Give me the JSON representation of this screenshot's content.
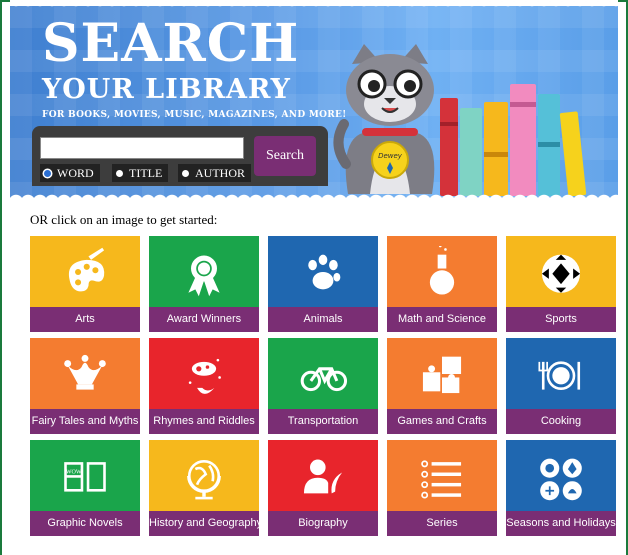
{
  "banner": {
    "title_line1": "SEARCH",
    "title_line2": "YOUR LIBRARY",
    "subtitle": "FOR BOOKS, MOVIES, MUSIC, MAGAZINES, AND MORE!",
    "cat_tag": "Dewey"
  },
  "search": {
    "input_value": "",
    "button_label": "Search",
    "options": [
      {
        "label": "WORD",
        "selected": true
      },
      {
        "label": "TITLE",
        "selected": false
      },
      {
        "label": "AUTHOR",
        "selected": false
      }
    ]
  },
  "intro_text": "OR click on an image to get started:",
  "categories": [
    {
      "label": "Arts",
      "color": "#f6b81c",
      "icon": "palette-icon"
    },
    {
      "label": "Award Winners",
      "color": "#1aa54b",
      "icon": "award-ribbon-icon"
    },
    {
      "label": "Animals",
      "color": "#1f67b0",
      "icon": "paw-print-icon"
    },
    {
      "label": "Math and Science",
      "color": "#f47c30",
      "icon": "flask-icon"
    },
    {
      "label": "Sports",
      "color": "#f6b81c",
      "icon": "soccer-ball-icon"
    },
    {
      "label": "Fairy Tales and Myths",
      "color": "#f47c30",
      "icon": "jester-hat-icon"
    },
    {
      "label": "Rhymes and Riddles",
      "color": "#e8252c",
      "icon": "cow-over-moon-icon"
    },
    {
      "label": "Transportation",
      "color": "#1aa54b",
      "icon": "bicycle-icon"
    },
    {
      "label": "Games and Crafts",
      "color": "#f47c30",
      "icon": "puzzle-icon"
    },
    {
      "label": "Cooking",
      "color": "#1f67b0",
      "icon": "plate-fork-knife-icon"
    },
    {
      "label": "Graphic Novels",
      "color": "#1aa54b",
      "icon": "comic-book-icon"
    },
    {
      "label": "History and Geography",
      "color": "#f6b81c",
      "icon": "globe-icon"
    },
    {
      "label": "Biography",
      "color": "#e8252c",
      "icon": "person-quill-icon"
    },
    {
      "label": "Series",
      "color": "#f47c30",
      "icon": "list-icon"
    },
    {
      "label": "Seasons and Holidays",
      "color": "#1f67b0",
      "icon": "seasons-icon"
    }
  ]
}
